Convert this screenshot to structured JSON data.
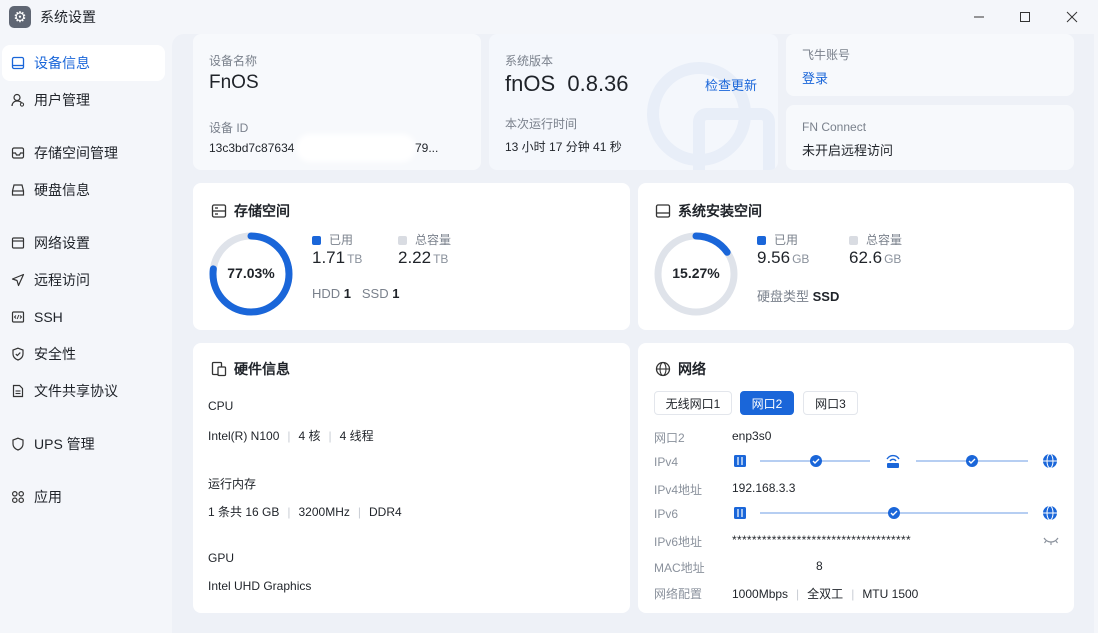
{
  "window": {
    "title": "系统设置"
  },
  "sidebar": {
    "items": [
      {
        "label": "设备信息",
        "icon": "monitor-icon",
        "active": true
      },
      {
        "label": "用户管理",
        "icon": "user-icon"
      },
      {
        "label": "存储空间管理",
        "icon": "storage-icon"
      },
      {
        "label": "硬盘信息",
        "icon": "disk-icon"
      },
      {
        "label": "网络设置",
        "icon": "network-icon"
      },
      {
        "label": "远程访问",
        "icon": "send-icon"
      },
      {
        "label": "SSH",
        "icon": "code-icon"
      },
      {
        "label": "安全性",
        "icon": "shield-icon"
      },
      {
        "label": "文件共享协议",
        "icon": "file-icon"
      },
      {
        "label": "UPS 管理",
        "icon": "ups-shield-icon"
      },
      {
        "label": "应用",
        "icon": "apps-grid-icon"
      }
    ]
  },
  "device": {
    "name_label": "设备名称",
    "name": "FnOS",
    "id_label": "设备 ID",
    "id_start": "13c3bd7c87634",
    "id_end": "79..."
  },
  "system": {
    "version_label": "系统版本",
    "version": "fnOS  0.8.36",
    "check_update": "检查更新",
    "uptime_label": "本次运行时间",
    "uptime": "13 小时 17 分钟 41 秒"
  },
  "account": {
    "label": "飞牛账号",
    "login": "登录"
  },
  "fn_connect": {
    "label": "FN Connect",
    "status": "未开启远程访问"
  },
  "storage": {
    "title": "存储空间",
    "percent_text": "77.03%",
    "percent": 0.7703,
    "used_label": "已用",
    "used_value": "1.71",
    "used_unit": "TB",
    "total_label": "总容量",
    "total_value": "2.22",
    "total_unit": "TB",
    "hdd_label": "HDD",
    "hdd_count": "1",
    "ssd_label": "SSD",
    "ssd_count": "1"
  },
  "sys_install": {
    "title": "系统安装空间",
    "percent_text": "15.27%",
    "percent": 0.1527,
    "used_label": "已用",
    "used_value": "9.56",
    "used_unit": "GB",
    "total_label": "总容量",
    "total_value": "62.6",
    "total_unit": "GB",
    "disk_type_label": "硬盘类型",
    "disk_type": "SSD"
  },
  "hardware": {
    "title": "硬件信息",
    "cpu_label": "CPU",
    "cpu_model": "Intel(R) N100",
    "cpu_cores": "4 核",
    "cpu_threads": "4 线程",
    "ram_label": "运行内存",
    "ram_sticks": "1 条共 16 GB",
    "ram_speed": "3200MHz",
    "ram_type": "DDR4",
    "gpu_label": "GPU",
    "gpu_model": "Intel UHD Graphics"
  },
  "network": {
    "title": "网络",
    "tabs": [
      "无线网口1",
      "网口2",
      "网口3"
    ],
    "active_tab": 1,
    "port_label": "网口2",
    "port_value": "enp3s0",
    "ipv4_label": "IPv4",
    "ipv4_addr_label": "IPv4地址",
    "ipv4_addr": "192.168.3.3",
    "ipv6_label": "IPv6",
    "ipv6_addr_label": "IPv6地址",
    "ipv6_addr": "************************************",
    "mac_label": "MAC地址",
    "mac_value": "8",
    "config_label": "网络配置",
    "speed": "1000Mbps",
    "duplex": "全双工",
    "mtu": "MTU 1500"
  },
  "colors": {
    "accent": "#1a66d9",
    "ring_track": "#dfe3ea",
    "legend_total": "#d9dce2"
  }
}
